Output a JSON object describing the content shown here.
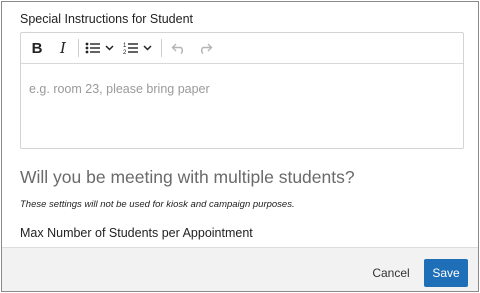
{
  "instructions": {
    "label": "Special Instructions for Student",
    "placeholder": "e.g. room 23, please bring paper",
    "value": ""
  },
  "toolbar": {
    "bold": "B",
    "italic": "I",
    "items": [
      "bold-icon",
      "italic-icon",
      "bulleted-list-icon",
      "numbered-list-icon",
      "undo-icon",
      "redo-icon"
    ]
  },
  "multiple_students": {
    "question": "Will you be meeting with multiple students?",
    "note": "These settings will not be used for kiosk and campaign purposes.",
    "max_label": "Max Number of Students per Appointment"
  },
  "footer": {
    "cancel_label": "Cancel",
    "save_label": "Save"
  },
  "colors": {
    "save_button": "#1f6fb8",
    "footer_bg": "#f2f2f2",
    "question_text": "#6a6a6a"
  }
}
